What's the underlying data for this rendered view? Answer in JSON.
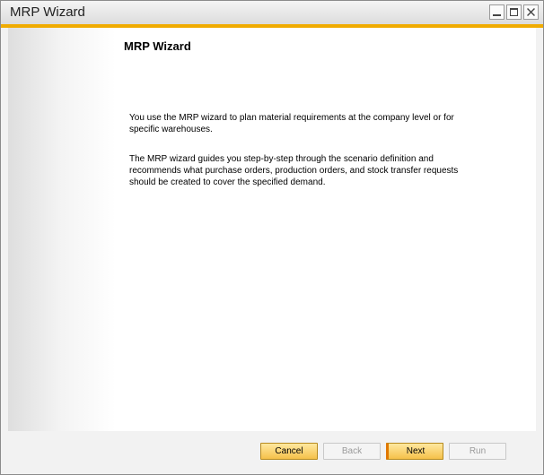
{
  "window": {
    "title": "MRP Wizard"
  },
  "content": {
    "heading": "MRP Wizard",
    "paragraph1": "You use the MRP wizard to plan material requirements at the company level or for specific warehouses.",
    "paragraph2": "The MRP wizard guides you step-by-step through the scenario definition and recommends what purchase orders, production orders, and stock transfer requests should be created to cover the specified demand."
  },
  "buttons": {
    "cancel": "Cancel",
    "back": "Back",
    "next": "Next",
    "run": "Run"
  },
  "colors": {
    "accent": "#f0ab00",
    "active_button": "#f5c14a",
    "next_indicator": "#e07800"
  }
}
